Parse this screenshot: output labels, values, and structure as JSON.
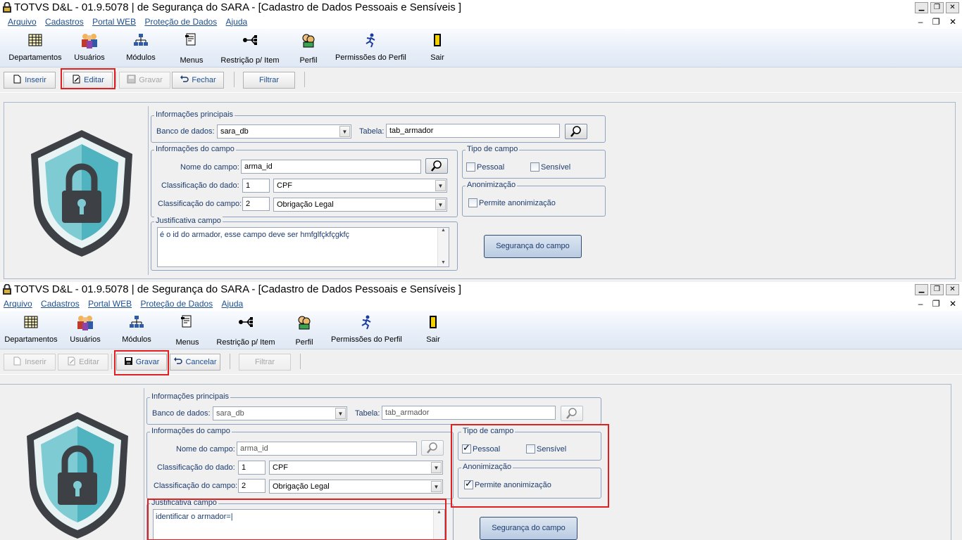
{
  "window": {
    "title": "TOTVS D&L - 01.9.5078 | de Segurança do SARA - [Cadastro de Dados Pessoais e Sensíveis ]",
    "minimize": "▁",
    "restore": "❐",
    "close": "✕"
  },
  "menu": {
    "items": [
      "Arquivo",
      "Cadastros",
      "Portal WEB",
      "Proteção de Dados",
      "Ajuda"
    ],
    "mdi": [
      "–",
      "❐",
      "✕"
    ]
  },
  "ribbon": {
    "items": [
      {
        "label": "Departamentos",
        "icon": "grid-table-icon"
      },
      {
        "label": "Usuários",
        "icon": "users-group-icon"
      },
      {
        "label": "Módulos",
        "icon": "modules-tree-icon"
      },
      {
        "label": "Menus",
        "icon": "menu-list-icon"
      },
      {
        "label": "Restrição p/ Item",
        "icon": "restriction-flow-icon"
      },
      {
        "label": "Perfil",
        "icon": "profile-person-icon"
      },
      {
        "label": "Permissões do Perfil",
        "icon": "running-figure-icon"
      },
      {
        "label": "Sair",
        "icon": "exit-door-icon"
      }
    ]
  },
  "toolbar_view": {
    "buttons": [
      "Inserir",
      "Editar",
      "Gravar",
      "Fechar"
    ],
    "filter": "Filtrar"
  },
  "toolbar_edit": {
    "buttons": [
      "Inserir",
      "Editar",
      "Gravar",
      "Cancelar"
    ],
    "filter": "Filtrar"
  },
  "form": {
    "group_main": "Informações principais",
    "db_label": "Banco de dados:",
    "db_value": "sara_db",
    "table_label": "Tabela:",
    "table_value": "tab_armador",
    "group_field": "Informações do campo",
    "field_name_label": "Nome do campo:",
    "field_name_value": "arma_id",
    "class_data_label": "Classificação do dado:",
    "class_data_code": "1",
    "class_data_value": "CPF",
    "class_field_label": "Classificação do campo:",
    "class_field_code": "2",
    "class_field_value": "Obrigação Legal",
    "group_type": "Tipo de campo",
    "personal_label": "Pessoal",
    "sensitive_label": "Sensível",
    "group_anon": "Anonimização",
    "anon_label": "Permite anonimização",
    "group_just": "Justificativa campo",
    "security_button": "Segurança do campo"
  },
  "state_view": {
    "justification": "é o id do armador, esse campo deve ser hmfglfçkfçgkfç",
    "personal_checked": false,
    "sensitive_checked": false,
    "anon_checked": false
  },
  "state_edit": {
    "justification": "identificar o armador=|",
    "personal_checked": true,
    "sensitive_checked": false,
    "anon_checked": true
  },
  "colors": {
    "highlight": "#e02020",
    "link_blue": "#1d4f91",
    "label_blue": "#1d3c6e",
    "shield_teal": "#6fc1cc",
    "shield_dark": "#3d4146"
  }
}
